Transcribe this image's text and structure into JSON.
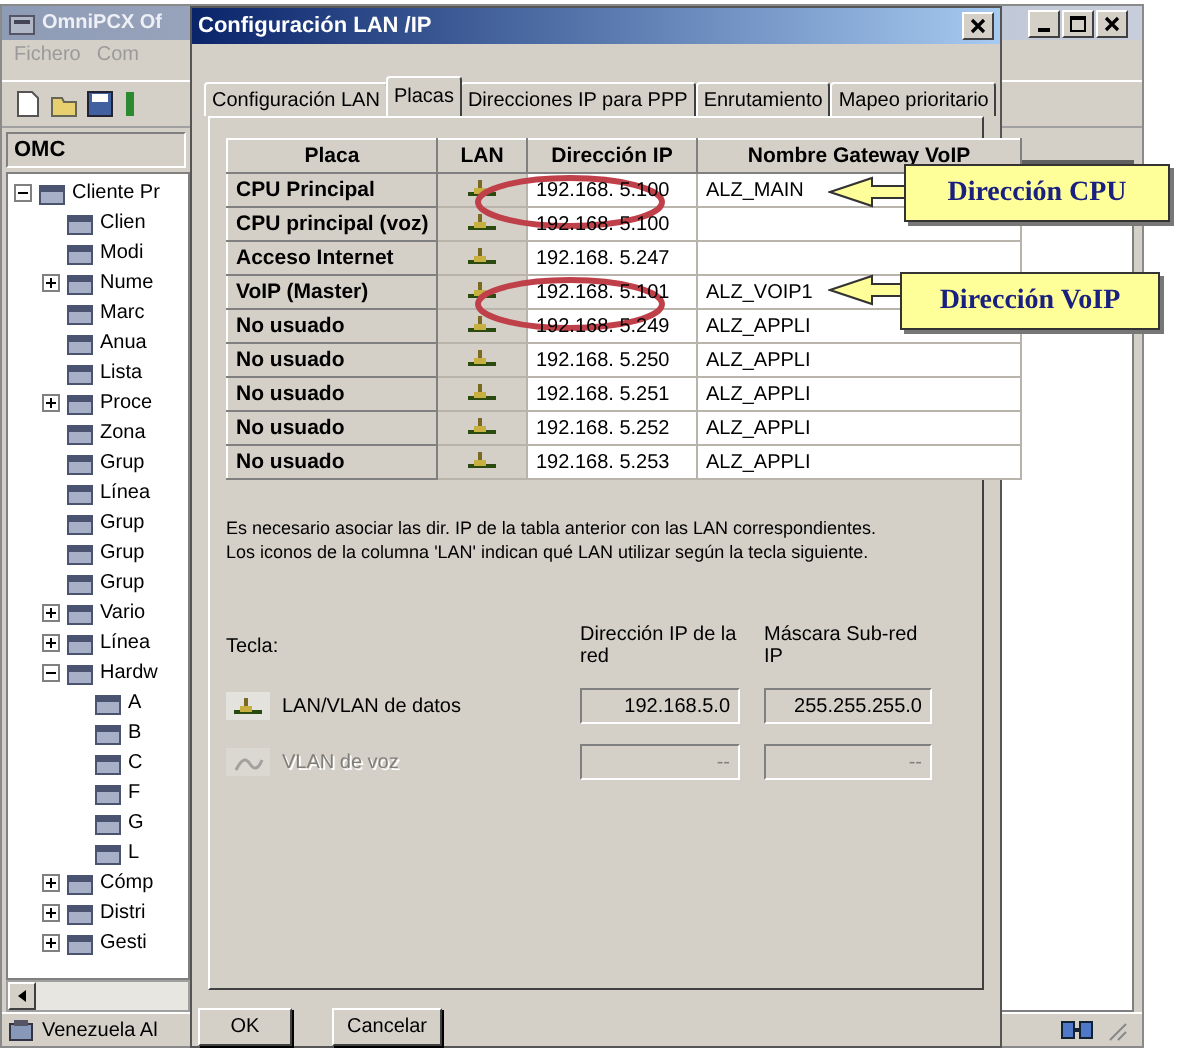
{
  "app_window": {
    "title": "OmniPCX Of",
    "menu": [
      "Fichero",
      "Com"
    ],
    "panel_title": "OMC",
    "tree": [
      {
        "label": "Cliente Pr",
        "expanded": true,
        "children": [
          {
            "label": "Clien"
          },
          {
            "label": "Modi"
          },
          {
            "label": "Nume",
            "expanded": false
          },
          {
            "label": "Marc"
          },
          {
            "label": "Anua"
          },
          {
            "label": "Lista"
          },
          {
            "label": "Proce",
            "expanded": false
          },
          {
            "label": "Zona"
          },
          {
            "label": "Grup"
          },
          {
            "label": "Línea"
          },
          {
            "label": "Grup"
          },
          {
            "label": "Grup"
          },
          {
            "label": "Grup"
          },
          {
            "label": "Vario",
            "expanded": false
          },
          {
            "label": "Línea",
            "expanded": false
          },
          {
            "label": "Hardw",
            "expanded": true,
            "children": [
              {
                "label": "A"
              },
              {
                "label": "B"
              },
              {
                "label": "C"
              },
              {
                "label": "F"
              },
              {
                "label": "G"
              },
              {
                "label": "L"
              }
            ]
          },
          {
            "label": "Cómp",
            "expanded": false
          },
          {
            "label": "Distri",
            "expanded": false
          },
          {
            "label": "Gesti",
            "expanded": false
          }
        ]
      }
    ],
    "status_bar": "Venezuela Al"
  },
  "dialog": {
    "title": "Configuración LAN /IP",
    "tabs": [
      {
        "label": "Configuración LAN",
        "selected": false
      },
      {
        "label": "Placas",
        "selected": true
      },
      {
        "label": "Direcciones IP para PPP",
        "selected": false
      },
      {
        "label": "Enrutamiento",
        "selected": false
      },
      {
        "label": "Mapeo prioritario",
        "selected": false
      }
    ],
    "table": {
      "columns": [
        "Placa",
        "LAN",
        "Dirección IP",
        "Nombre Gateway VoIP"
      ],
      "rows": [
        {
          "placa": "CPU Principal",
          "ip": "192.168. 5.100",
          "gateway": "ALZ_MAIN"
        },
        {
          "placa": "CPU principal (voz)",
          "ip": "192.168. 5.100"
        },
        {
          "placa": "Acceso Internet",
          "ip": "192.168. 5.247"
        },
        {
          "placa": "VoIP (Master)",
          "ip": "192.168. 5.101",
          "gateway": "ALZ_VOIP1"
        },
        {
          "placa": "No usuado",
          "ip": "192.168. 5.249",
          "gateway": "ALZ_APPLI"
        },
        {
          "placa": "No usuado",
          "ip": "192.168. 5.250",
          "gateway": "ALZ_APPLI"
        },
        {
          "placa": "No usuado",
          "ip": "192.168. 5.251",
          "gateway": "ALZ_APPLI"
        },
        {
          "placa": "No usuado",
          "ip": "192.168. 5.252",
          "gateway": "ALZ_APPLI"
        },
        {
          "placa": "No usuado",
          "ip": "192.168. 5.253",
          "gateway": "ALZ_APPLI"
        }
      ]
    },
    "note": [
      "Es necesario asociar las dir. IP de la tabla anterior con las LAN correspondientes.",
      "Los iconos de la columna 'LAN' indican qué LAN utilizar según la tecla siguiente."
    ],
    "key_label": "Tecla:",
    "key_columns": [
      "Dirección IP de la red",
      "Máscara Sub-red IP"
    ],
    "key_rows": [
      {
        "label": "LAN/VLAN de datos",
        "disabled": false,
        "ip": "192.168.5.0",
        "mask": "255.255.255.0"
      },
      {
        "label": "VLAN de voz",
        "disabled": true,
        "ip": "--",
        "mask": "--"
      }
    ],
    "buttons": [
      "OK",
      "Cancelar"
    ]
  },
  "annotations": [
    {
      "text": "Dirección CPU"
    },
    {
      "text": "Dirección VoIP"
    }
  ]
}
